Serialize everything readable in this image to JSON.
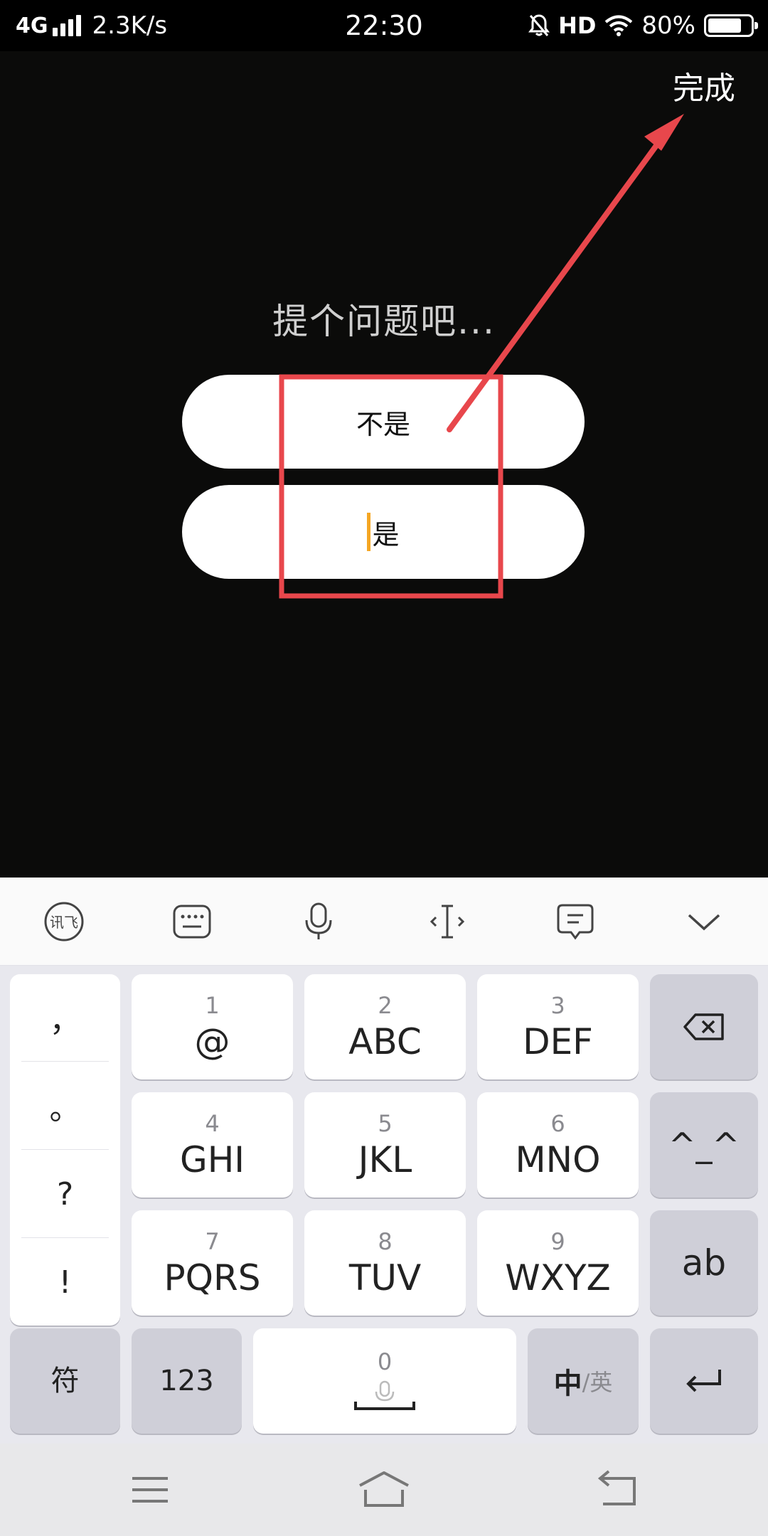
{
  "status": {
    "network": "4G",
    "speed": "2.3K/s",
    "time": "22:30",
    "hd": "HD",
    "battery": "80%",
    "battery_level": 0.8
  },
  "main": {
    "done_label": "完成",
    "question": "提个问题吧...",
    "options": [
      "不是",
      "是"
    ]
  },
  "keyboard": {
    "punctuation": [
      "，",
      "。",
      "?",
      "!"
    ],
    "keys": [
      {
        "num": "1",
        "letters": "@"
      },
      {
        "num": "2",
        "letters": "ABC"
      },
      {
        "num": "3",
        "letters": "DEF"
      },
      {
        "num": "4",
        "letters": "GHI"
      },
      {
        "num": "5",
        "letters": "JKL"
      },
      {
        "num": "6",
        "letters": "MNO"
      },
      {
        "num": "7",
        "letters": "PQRS"
      },
      {
        "num": "8",
        "letters": "TUV"
      },
      {
        "num": "9",
        "letters": "WXYZ"
      }
    ],
    "emoticon": "^_^",
    "ab": "ab",
    "symbols": "符",
    "numbers": "123",
    "space_num": "0",
    "lang_main": "中",
    "lang_alt": "/英"
  },
  "colors": {
    "annotation": "#e8474c",
    "caret": "#f5a623"
  }
}
